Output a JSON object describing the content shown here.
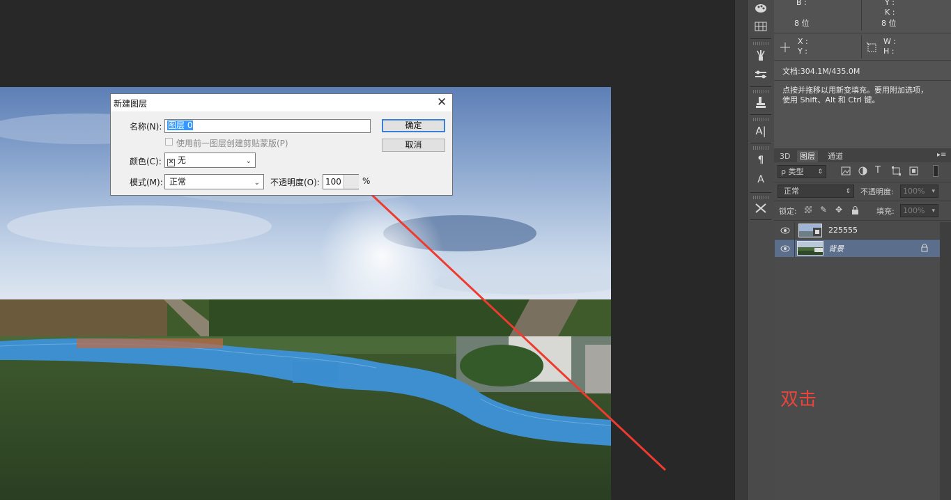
{
  "info_panel": {
    "b_label": "B :",
    "y_label": "Y :",
    "k_label": "K :",
    "bit_left": "8 位",
    "bit_right": "8 位",
    "x_label": "X :",
    "y2_label": "Y :",
    "w_label": "W :",
    "h_label": "H :",
    "doc_size": "文档:304.1M/435.0M",
    "hint": "点按并拖移以用新变填充。要用附加选项，使用 Shift、Alt 和 Ctrl 键。"
  },
  "layers_panel": {
    "tabs": [
      "3D",
      "图层",
      "通道"
    ],
    "filter_label": "ρ 类型",
    "blend_mode": "正常",
    "opacity_label": "不透明度:",
    "opacity_value": "100%",
    "lock_label": "锁定:",
    "fill_label": "填充:",
    "fill_value": "100%",
    "layers": [
      {
        "name": "225555",
        "visible": true,
        "selected": false
      },
      {
        "name": "背景",
        "visible": true,
        "selected": true,
        "locked": true
      }
    ]
  },
  "dialog": {
    "title": "新建图层",
    "name_label": "名称(N):",
    "name_value": "图层 0",
    "clip_checkbox_label": "使用前一图层创建剪贴蒙版(P)",
    "clip_checked": false,
    "color_label": "颜色(C):",
    "color_value": "无",
    "mode_label": "模式(M):",
    "mode_value": "正常",
    "opacity_label": "不透明度(O):",
    "opacity_value": "100",
    "percent": "%",
    "ok_label": "确定",
    "cancel_label": "取消"
  },
  "annotation": {
    "text": "双击",
    "color": "#e8453c"
  },
  "colors": {
    "app_bg": "#282828",
    "panel_bg": "#535353",
    "selected_layer": "#5b6f8c",
    "dialog_bg": "#f0f0f0"
  }
}
